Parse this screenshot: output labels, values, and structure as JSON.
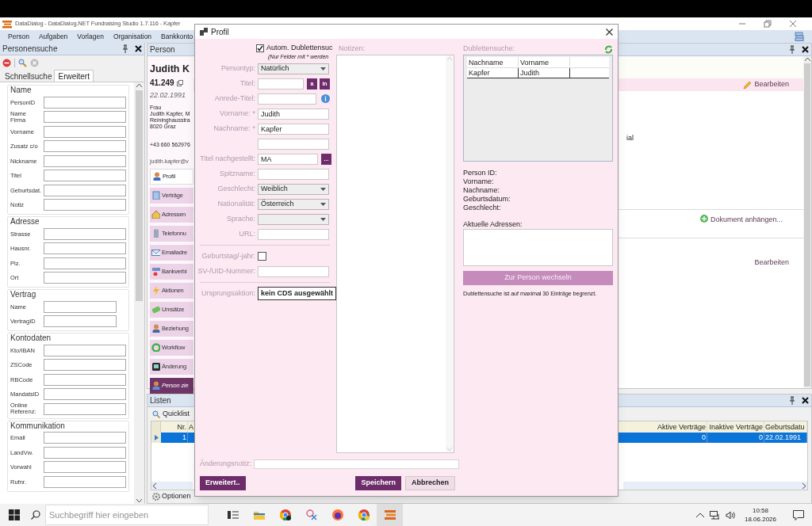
{
  "window": {
    "title": "DataDialog - DataDialog.NET Fundraising Studio 1.7.116 - Kapfer"
  },
  "menu": [
    "Person",
    "Aufgaben",
    "Vorlagen",
    "Organisation",
    "Bankkonto"
  ],
  "search_panel": {
    "title": "Personensuche",
    "tabs": [
      {
        "label": "Schnellsuche",
        "selected": false
      },
      {
        "label": "Erweitert",
        "selected": true
      }
    ],
    "groups": [
      {
        "title": "Name",
        "narrow": false,
        "fields": [
          {
            "label": "PersonID",
            "wrap": false
          },
          {
            "label": "Name Firma",
            "wrap": true
          },
          {
            "label": "Vorname",
            "wrap": false
          },
          {
            "label": "Zusatz c/o",
            "wrap": false
          },
          {
            "label": "Nickname",
            "wrap": false
          },
          {
            "label": "Titel",
            "wrap": false
          },
          {
            "label": "Geburtsdat.",
            "wrap": false
          },
          {
            "label": "Notiz",
            "wrap": false
          }
        ]
      },
      {
        "title": "Adresse",
        "narrow": false,
        "fields": [
          {
            "label": "Strasse",
            "wrap": false
          },
          {
            "label": "Hausnr.",
            "wrap": false
          },
          {
            "label": "Plz.",
            "wrap": false
          },
          {
            "label": "Ort",
            "wrap": false
          }
        ]
      },
      {
        "title": "Vertrag",
        "narrow": true,
        "fields": [
          {
            "label": "Name",
            "wrap": false
          },
          {
            "label": "VertragID",
            "wrap": false
          }
        ]
      },
      {
        "title": "Kontodaten",
        "narrow": false,
        "fields": [
          {
            "label": "Kto/IBAN",
            "wrap": false
          },
          {
            "label": "ZSCode",
            "wrap": false
          },
          {
            "label": "RBCode",
            "wrap": false
          },
          {
            "label": "MandatsID",
            "wrap": false
          },
          {
            "label": "Online Referenz:",
            "wrap": true
          }
        ]
      },
      {
        "title": "Kommunikation",
        "narrow": false,
        "fields": [
          {
            "label": "Email",
            "wrap": false
          },
          {
            "label": "LandVw.",
            "wrap": false
          },
          {
            "label": "Vorwahl",
            "wrap": false
          },
          {
            "label": "Rufnr.",
            "wrap": false
          }
        ]
      }
    ]
  },
  "person_panel": {
    "title": "Person",
    "name": "Judith K",
    "number": "41.249",
    "birthdate": "22.02.1991",
    "address_lines": [
      "Frau",
      "Judith Kapfer, M",
      "Reininghausstra",
      "8020 Graz"
    ],
    "phone": "+43 660 562976",
    "email": "judith.kapfer@v",
    "nav": [
      {
        "label": "Profil",
        "kind": "tab",
        "selected": true
      },
      {
        "label": "Verträge",
        "kind": "tab",
        "selected": false
      },
      {
        "label": "Adressen",
        "kind": "tab",
        "selected": false
      },
      {
        "label": "Telefonnu",
        "kind": "tab",
        "selected": false
      },
      {
        "label": "Emailadre",
        "kind": "tab",
        "selected": false
      },
      {
        "label": "Bankverbi",
        "kind": "tab",
        "selected": false
      },
      {
        "label": "Aktionen",
        "kind": "tab",
        "selected": false
      },
      {
        "label": "Umsätze",
        "kind": "tab",
        "selected": false
      },
      {
        "label": "Beziehung",
        "kind": "tab",
        "selected": false
      },
      {
        "label": "Workflow",
        "kind": "tab",
        "selected": false
      },
      {
        "label": "Änderung",
        "kind": "tab",
        "selected": false
      },
      {
        "label": "Person zie",
        "kind": "action",
        "selected": false
      }
    ],
    "edit_link": "Bearbeiten",
    "text_fragment": "ial",
    "attach_link": "Dokument anhängen...",
    "edit_link_2": "Bearbeiten"
  },
  "lists_panel": {
    "title": "Listen",
    "tab": "Quicklist",
    "columns": [
      "Nr.",
      "A",
      "Aktive Verträge",
      "Inaktive Verträge",
      "Geburtsdatu"
    ],
    "rows": [
      {
        "selected": true,
        "nr": "1",
        "active": "0",
        "inactive": "0",
        "birthdate": "22.02.1991"
      }
    ],
    "options": "Optionen"
  },
  "dialog": {
    "title": "Profil",
    "auto_check": {
      "label": "Autom. Dublettensuc",
      "checked": true
    },
    "hint": "(Nur Felder mit * werden",
    "fields": [
      {
        "kind": "select",
        "label": "Persontyp:",
        "value": "Natürlich"
      },
      {
        "kind": "text",
        "label": "Titel:",
        "buttons": [
          "a",
          "in"
        ]
      },
      {
        "kind": "text",
        "label": "Anrede-Titel:",
        "info": true
      },
      {
        "kind": "text",
        "label": "Vorname:",
        "required_mark": "*",
        "value": "Judith"
      },
      {
        "kind": "text",
        "label": "Nachname:",
        "required_mark": "*",
        "value": "Kapfer"
      },
      {
        "kind": "text"
      },
      {
        "kind": "text",
        "label": "Titel nachgestellt:",
        "value": "MA",
        "buttons": [
          "..."
        ]
      },
      {
        "kind": "text",
        "label": "Spitzname:"
      },
      {
        "kind": "select",
        "label": "Geschlecht:",
        "value": "Weiblich"
      },
      {
        "kind": "select",
        "label": "Nationalität:",
        "value": "Österreich"
      },
      {
        "kind": "select",
        "label": "Sprache:"
      },
      {
        "kind": "text",
        "label": "URL:"
      },
      {
        "kind": "divider"
      },
      {
        "kind": "checkbox",
        "label": "Geburtstag/-jahr:",
        "checked": false
      },
      {
        "kind": "text",
        "label": "SV-/UID-Nummer:"
      },
      {
        "kind": "divider"
      },
      {
        "kind": "button",
        "label": "Ursprungsaktion:",
        "value": "kein CDS ausgewählt"
      }
    ],
    "notes_label": "Notizen:",
    "duplicates": {
      "label": "Dublettensuche:",
      "columns": [
        "Nachname",
        "Vorname"
      ],
      "rows": [
        [
          "Kapfer",
          "Judith"
        ]
      ],
      "details": [
        "Person ID:",
        "Vorname:",
        "Nachname:",
        "Geburtsdatum:",
        "Geschlecht:"
      ],
      "addresses_label": "Aktuelle Adressen:",
      "switch_button": {
        "label": "Zur Person wechseln",
        "disabled": true
      },
      "limit_note": "Dublettensuche ist auf maximal 30 Einträge begrenzt."
    },
    "change_note_label": "Änderungsnotiz:",
    "buttons": [
      {
        "label": "Erweitert..",
        "kind": "primary"
      },
      {
        "label": "Speichern",
        "kind": "primary"
      },
      {
        "label": "Abbrechen",
        "kind": "secondary"
      }
    ]
  },
  "taskbar": {
    "search_placeholder": "Suchbegriff hier eingeben",
    "time": "10:58",
    "date": "18.06.2026"
  }
}
